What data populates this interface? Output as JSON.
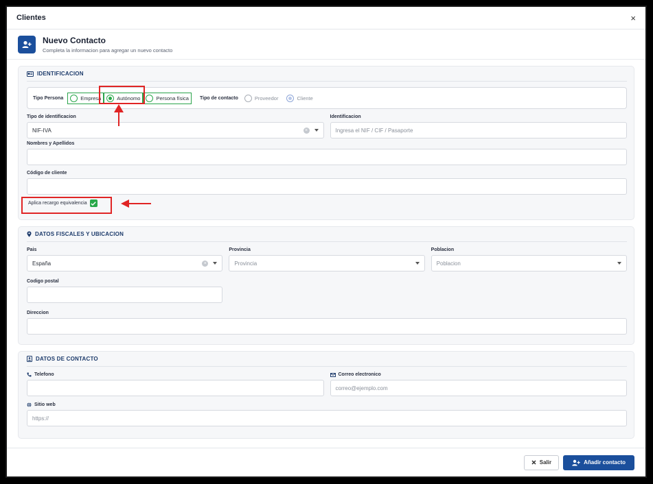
{
  "window": {
    "title": "Clientes",
    "close": "×"
  },
  "header": {
    "title": "Nuevo Contacto",
    "subtitle": "Completa la informacion para agregar un nuevo contacto"
  },
  "identificacion": {
    "title": "IDENTIFICACION",
    "tipo_persona": {
      "label": "Tipo Persona",
      "options": [
        "Empresa",
        "Autónomo",
        "Persona física"
      ],
      "selected": "Autónomo"
    },
    "tipo_contacto": {
      "label": "Tipo de contacto",
      "options": [
        "Proveedor",
        "Cliente"
      ],
      "selected": "Cliente"
    },
    "tipo_identificacion": {
      "label": "Tipo de identificacion",
      "value": "NIF-IVA"
    },
    "identificacion": {
      "label": "Identificacion",
      "placeholder": "Ingresa el NIF / CIF / Pasaporte"
    },
    "nombres": {
      "label": "Nombres y Apellidos",
      "value": ""
    },
    "codigo_cliente": {
      "label": "Código de cliente",
      "value": ""
    },
    "recargo": {
      "label": "Aplica recargo equivalencia",
      "checked": true
    }
  },
  "fiscales": {
    "title": "DATOS FISCALES Y UBICACION",
    "pais": {
      "label": "Pais",
      "value": "España"
    },
    "provincia": {
      "label": "Provincia",
      "placeholder": "Provincia"
    },
    "poblacion": {
      "label": "Poblacion",
      "placeholder": "Poblacion"
    },
    "codigo_postal": {
      "label": "Codigo postal",
      "value": ""
    },
    "direccion": {
      "label": "Direccion",
      "value": ""
    }
  },
  "contacto": {
    "title": "DATOS DE CONTACTO",
    "telefono": {
      "label": "Telefono",
      "value": ""
    },
    "correo": {
      "label": "Correo electronico",
      "placeholder": "correo@ejemplo.com"
    },
    "web": {
      "label": "Sitio web",
      "placeholder": "https://"
    }
  },
  "footer": {
    "salir": "Salir",
    "anadir": "Añadir contacto"
  },
  "colors": {
    "primary": "#1b4f9c",
    "success": "#29a84a",
    "annotation": "#e02424"
  }
}
